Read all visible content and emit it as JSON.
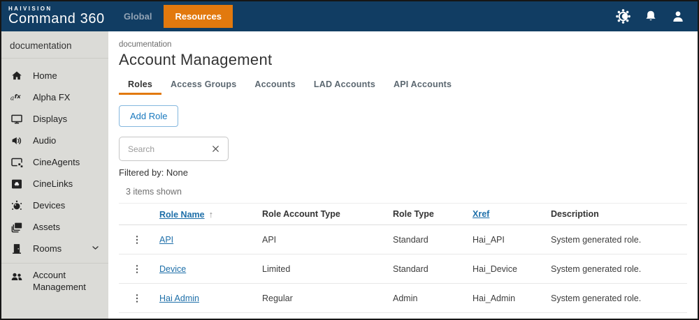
{
  "topbar": {
    "brand_small": "HAIVISION",
    "brand_large": "Command 360",
    "nav": [
      {
        "label": "Global",
        "active": false
      },
      {
        "label": "Resources",
        "active": true
      }
    ],
    "icons": [
      "theme-toggle-icon",
      "notifications-bell-icon",
      "user-icon"
    ]
  },
  "sidebar": {
    "header": "documentation",
    "items": [
      {
        "label": "Home",
        "icon": "home-icon"
      },
      {
        "label": "Alpha FX",
        "icon": "alpha-fx-icon"
      },
      {
        "label": "Displays",
        "icon": "display-icon"
      },
      {
        "label": "Audio",
        "icon": "audio-icon"
      },
      {
        "label": "CineAgents",
        "icon": "cineagents-icon"
      },
      {
        "label": "CineLinks",
        "icon": "cinelinks-icon"
      },
      {
        "label": "Devices",
        "icon": "devices-icon"
      },
      {
        "label": "Assets",
        "icon": "assets-icon"
      },
      {
        "label": "Rooms",
        "icon": "rooms-icon",
        "expandable": true
      },
      {
        "label": "Account Management",
        "icon": "account-management-icon"
      }
    ]
  },
  "main": {
    "breadcrumb": "documentation",
    "title": "Account Management",
    "tabs": [
      {
        "label": "Roles",
        "active": true
      },
      {
        "label": "Access Groups",
        "active": false
      },
      {
        "label": "Accounts",
        "active": false
      },
      {
        "label": "LAD Accounts",
        "active": false
      },
      {
        "label": "API Accounts",
        "active": false
      }
    ],
    "add_button": "Add Role",
    "search_placeholder": "Search",
    "filter_label": "Filtered by: None",
    "items_shown": "3 items shown",
    "table": {
      "columns": [
        {
          "label": "Role Name",
          "sortable": true,
          "sort_indicator": "↑"
        },
        {
          "label": "Role Account Type",
          "sortable": false
        },
        {
          "label": "Role Type",
          "sortable": false
        },
        {
          "label": "Xref",
          "sortable": true
        },
        {
          "label": "Description",
          "sortable": false
        }
      ],
      "rows": [
        {
          "role_name": "API",
          "role_account_type": "API",
          "role_type": "Standard",
          "xref": "Hai_API",
          "description": "System generated role."
        },
        {
          "role_name": "Device",
          "role_account_type": "Limited",
          "role_type": "Standard",
          "xref": "Hai_Device",
          "description": "System generated role."
        },
        {
          "role_name": "Hai Admin",
          "role_account_type": "Regular",
          "role_type": "Admin",
          "xref": "Hai_Admin",
          "description": "System generated role."
        }
      ]
    }
  },
  "colors": {
    "navy": "#113d63",
    "orange": "#e2790e",
    "link_blue": "#1e6fa9",
    "sidebar_bg": "#dbdbd7"
  }
}
